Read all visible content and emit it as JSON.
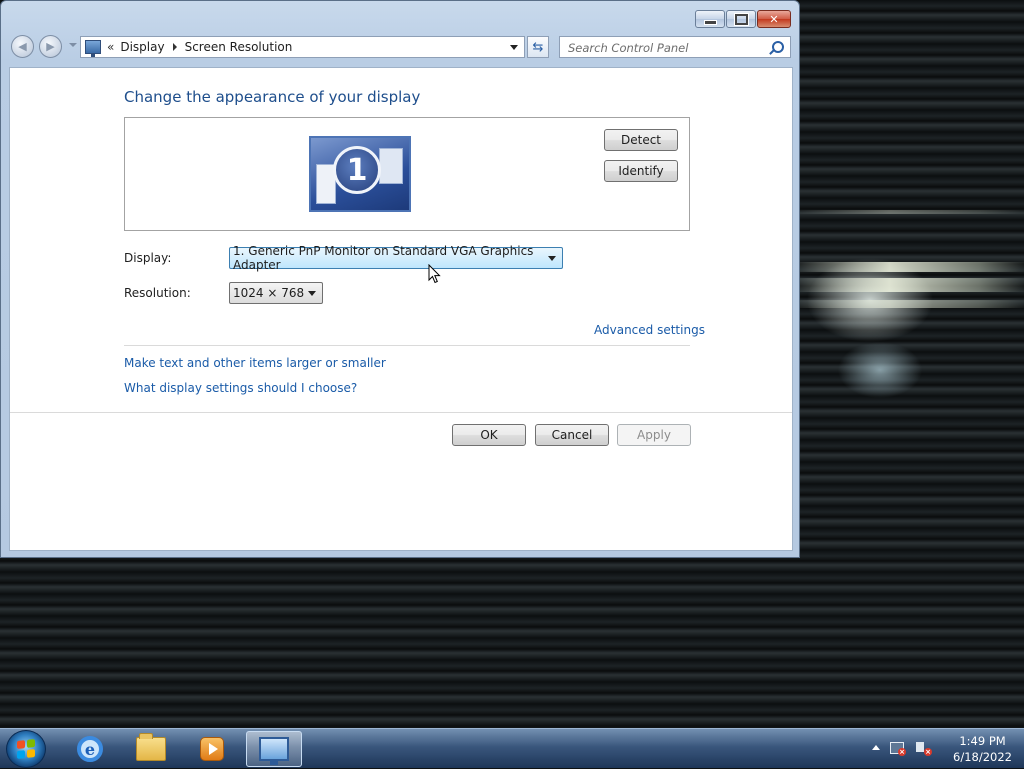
{
  "window": {
    "address": {
      "chevron": "«",
      "crumbs": [
        "Display",
        "Screen Resolution"
      ]
    },
    "search": {
      "placeholder": "Search Control Panel"
    }
  },
  "content": {
    "heading": "Change the appearance of your display",
    "monitor_number": "1",
    "detect_label": "Detect",
    "identify_label": "Identify",
    "display_label": "Display:",
    "display_value": "1. Generic PnP Monitor on Standard VGA Graphics Adapter",
    "resolution_label": "Resolution:",
    "resolution_value": "1024 × 768",
    "advanced_link": "Advanced settings",
    "links": [
      "Make text and other items larger or smaller",
      "What display settings should I choose?"
    ],
    "ok_label": "OK",
    "cancel_label": "Cancel",
    "apply_label": "Apply"
  },
  "taskbar": {
    "items": [
      "start-button",
      "internet-explorer",
      "windows-explorer",
      "windows-media-player",
      "screen-resolution"
    ],
    "active_item": "screen-resolution",
    "clock": {
      "time": "1:49 PM",
      "date": "6/18/2022"
    }
  }
}
